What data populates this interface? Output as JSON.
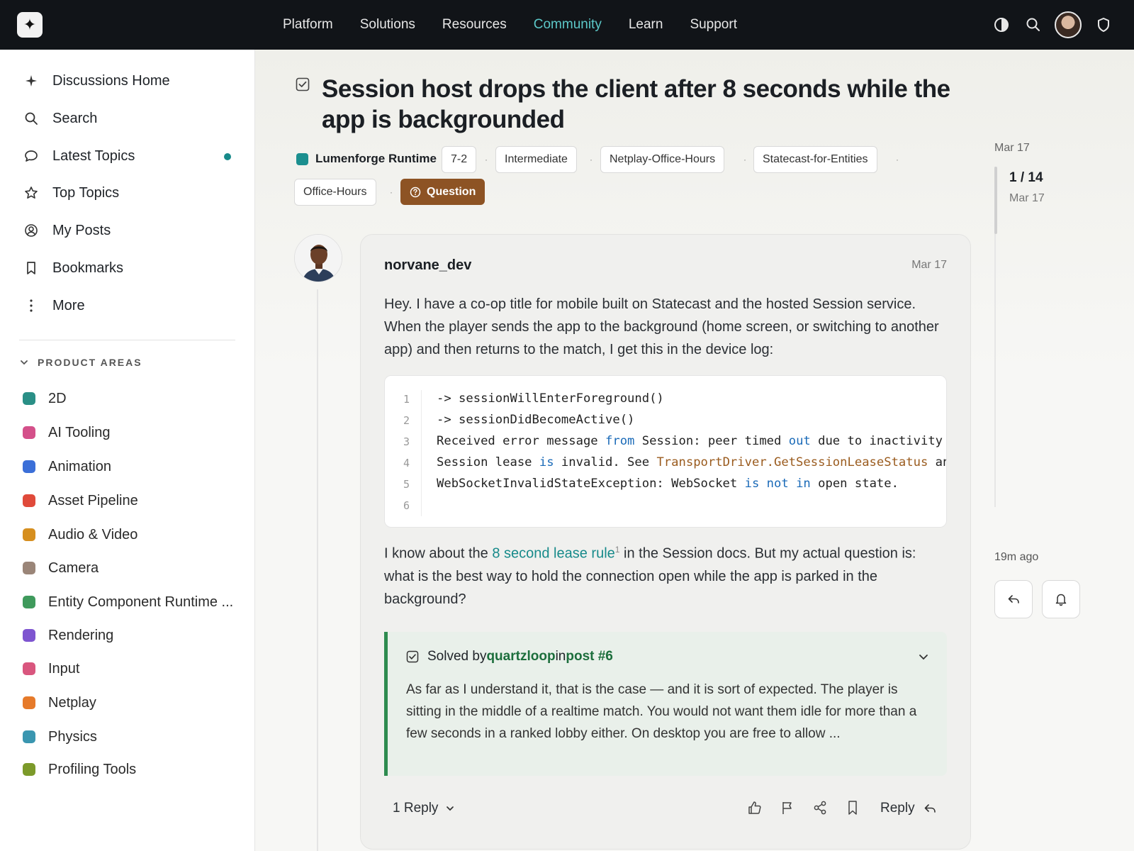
{
  "nav": {
    "items": [
      "Platform",
      "Solutions",
      "Resources",
      "Community",
      "Learn",
      "Support"
    ],
    "active": "Community"
  },
  "sidebar": {
    "items": [
      {
        "label": "Discussions Home",
        "icon": "sparkle-icon"
      },
      {
        "label": "Search",
        "icon": "search-icon"
      },
      {
        "label": "Latest Topics",
        "icon": "chat-bubble-icon"
      },
      {
        "label": "Top Topics",
        "icon": "star-icon"
      },
      {
        "label": "My Posts",
        "icon": "user-circle-icon"
      },
      {
        "label": "Bookmarks",
        "icon": "bookmark-icon"
      },
      {
        "label": "More",
        "icon": "more-vertical-icon"
      }
    ],
    "section_title": "PRODUCT AREAS",
    "categories": [
      {
        "label": "2D",
        "color": "#2a8f86"
      },
      {
        "label": "AI Tooling",
        "color": "#d4508a"
      },
      {
        "label": "Animation",
        "color": "#3b6fd8"
      },
      {
        "label": "Asset Pipeline",
        "color": "#e04a3a"
      },
      {
        "label": "Audio & Video",
        "color": "#d68f1f"
      },
      {
        "label": "Camera",
        "color": "#9a8578"
      },
      {
        "label": "Entity Component Runtime ...",
        "color": "#3f9a5c"
      },
      {
        "label": "Rendering",
        "color": "#7e55d0"
      },
      {
        "label": "Input",
        "color": "#d9567e"
      },
      {
        "label": "Netplay",
        "color": "#e67a2a"
      },
      {
        "label": "Physics",
        "color": "#3a96b0"
      },
      {
        "label": "Profiling Tools",
        "color": "#7c9a2a"
      }
    ]
  },
  "topic": {
    "title": "Session host drops the client after 8 seconds while the app is backgrounded",
    "category": "Lumenforge Runtime",
    "tags": [
      "7-2",
      "Intermediate",
      "Netplay-Office-Hours",
      "Statecast-for-Entities",
      "Office-Hours"
    ],
    "badge": "Question"
  },
  "post": {
    "author": "norvane_dev",
    "date": "Mar 17",
    "para1": "Hey. I have a co-op title for mobile built on Statecast and the hosted Session service. When the player sends the app to the background (home screen, or switching to another app) and then returns to the match, I get this in the device log:",
    "code_lines": [
      "1",
      "2",
      "3",
      "4",
      "5",
      "6"
    ],
    "para2_a": "I know about the ",
    "para2_link": "8 second lease rule",
    "para2_fn": "1",
    "para2_b": " in the Session docs. But my actual question is: what is the best way to hold the connection open while the app is parked in the background?",
    "solved_prefix": "Solved by ",
    "solved_user": "quartzloop",
    "solved_in": " in ",
    "solved_post": "post #6",
    "solved_text": "As far as I understand it, that is the case — and it is sort of expected. The player is sitting in the middle of a realtime match. You would not want them idle for more than a few seconds in a ranked lobby either. On desktop you are free to allow ...",
    "reply_count": "1 Reply",
    "reply_label": "Reply"
  },
  "timeline": {
    "top_date": "Mar 17",
    "count": "1 / 14",
    "count_date": "Mar 17",
    "ago": "19m ago"
  }
}
